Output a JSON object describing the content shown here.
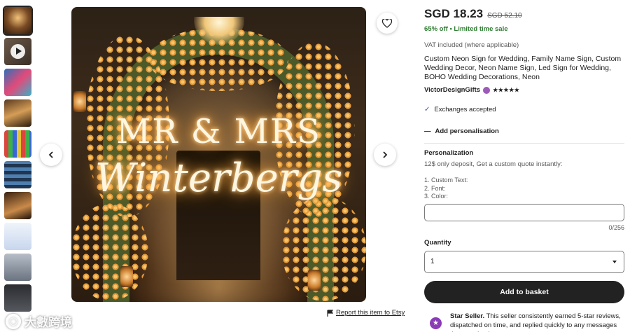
{
  "gallery": {
    "thumbnail_count": 10,
    "main_image": {
      "neon_line1": "MR & MRS",
      "neon_line2": "Winterbergs"
    },
    "report_label": "Report this item to Etsy"
  },
  "watermark": {
    "text": "大數跨境"
  },
  "listing": {
    "price": "SGD 18.23",
    "price_original": "SGD 52.10",
    "discount": "65% off",
    "deal_label": "Limited time sale",
    "vat_note": "VAT included (where applicable)",
    "title": "Custom Neon Sign for Wedding, Family Name Sign, Custom Wedding Decor, Neon Name Sign, Led Sign for Wedding, BOHO Wedding Decorations, Neon",
    "shop_name": "VictorDesignGifts",
    "rating_stars": "★★★★★",
    "exchanges": "Exchanges accepted",
    "add_personalisation": "Add personalisation"
  },
  "personalization": {
    "heading": "Personalization",
    "instructions": "12$ only deposit, Get a custom quote instantly:",
    "line1": "1. Custom Text:",
    "line2": "2. Font:",
    "line3": "3. Color:",
    "input_value": "",
    "counter": "0/256"
  },
  "quantity": {
    "label": "Quantity",
    "selected": "1"
  },
  "cta": {
    "add_to_basket": "Add to basket"
  },
  "star_seller": {
    "title": "Star Seller.",
    "description": "This seller consistently earned 5-star reviews, dispatched on time, and replied quickly to any messages they received."
  },
  "colors": {
    "deal_green": "#2f7d32",
    "star_seller_purple": "#8a3bb5",
    "button_dark": "#222222"
  }
}
